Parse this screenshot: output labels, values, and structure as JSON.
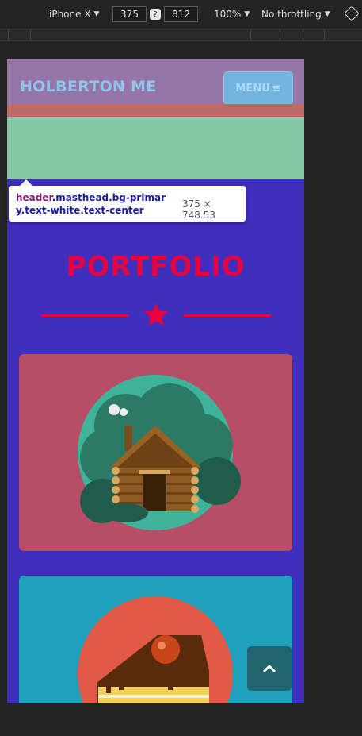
{
  "devtools": {
    "device": "iPhone X",
    "width": "375",
    "height": "812",
    "zoom": "100%",
    "throttling": "No throttling"
  },
  "site": {
    "brand": "HOLBERTON ME",
    "menu_label": "MENU",
    "section_title": "PORTFOLIO"
  },
  "inspector_tooltip": {
    "selector_tag": "header",
    "selector_classes": ".masthead.bg-primary.text-white.text-center",
    "dimensions": "375 × 748.53"
  },
  "colors": {
    "page_bg": "#3f2fbd",
    "accent": "#e8003f",
    "navbar": "#9675a9",
    "card1": "#b84d67",
    "card2": "#20a0bb"
  },
  "icons": [
    "chevron-down-icon",
    "swap-icon",
    "rotate-icon",
    "hamburger-icon",
    "star-icon",
    "cabin-image",
    "cake-image",
    "chevron-up-icon"
  ]
}
